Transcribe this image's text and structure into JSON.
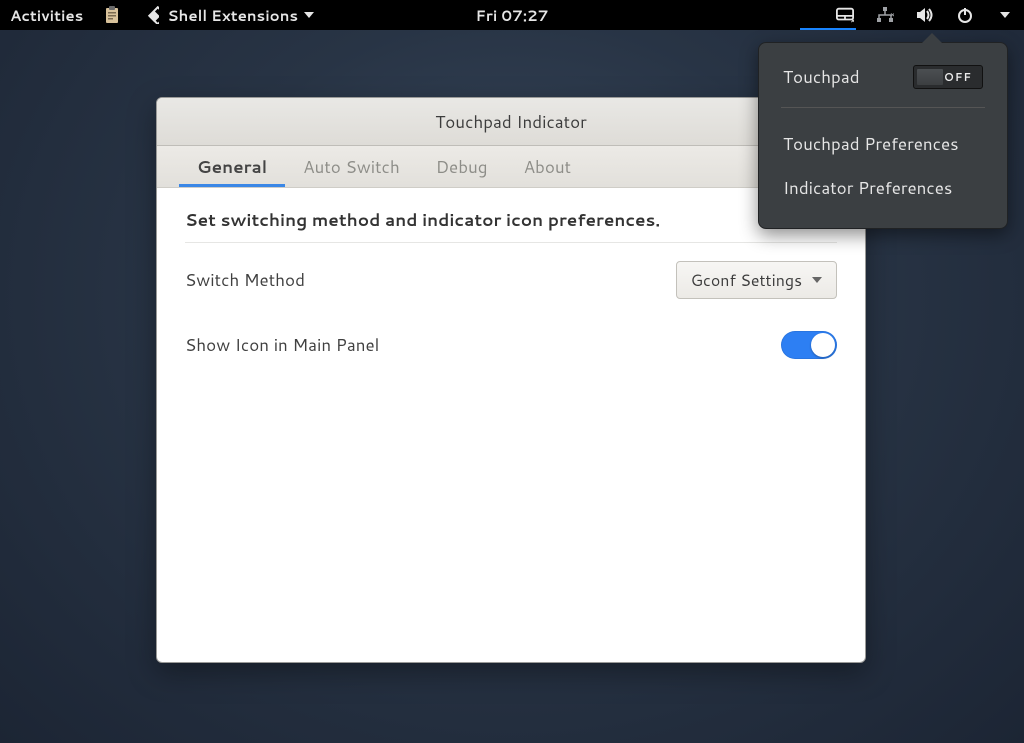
{
  "topbar": {
    "activities": "Activities",
    "app_name": "Shell Extensions",
    "clock": "Fri 07:27"
  },
  "popover": {
    "touchpad_label": "Touchpad",
    "touchpad_state": "OFF",
    "touchpad_preferences": "Touchpad Preferences",
    "indicator_preferences": "Indicator Preferences"
  },
  "window": {
    "title": "Touchpad Indicator",
    "tabs": {
      "general": "General",
      "auto_switch": "Auto Switch",
      "debug": "Debug",
      "about": "About"
    },
    "general": {
      "description": "Set switching method and indicator icon preferences.",
      "switch_method_label": "Switch Method",
      "switch_method_value": "Gconf Settings",
      "show_icon_label": "Show Icon in Main Panel",
      "show_icon_on": true
    }
  }
}
